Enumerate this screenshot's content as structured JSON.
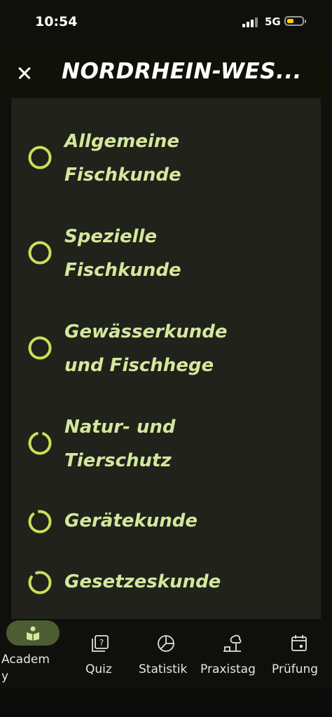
{
  "status_bar": {
    "time": "10:54",
    "network": "5G"
  },
  "header": {
    "title": "NORDRHEIN-WES..."
  },
  "topics": [
    {
      "line1": "Allgemeine",
      "line2": "Fischkunde",
      "progress": 0
    },
    {
      "line1": "Spezielle",
      "line2": "Fischkunde",
      "progress": 0
    },
    {
      "line1": "Gewässerkunde",
      "line2": "und Fischhege",
      "progress": 0
    },
    {
      "line1": "Natur- und",
      "line2": "Tierschutz",
      "progress": 0.1
    },
    {
      "line1": "Gerätekunde",
      "line2": "",
      "progress": 0.1
    },
    {
      "line1": "Gesetzeskunde",
      "line2": "",
      "progress": 0.1
    }
  ],
  "nav": {
    "academy": "Academ\ny",
    "quiz": "Quiz",
    "statistik": "Statistik",
    "praxistag": "Praxistag",
    "pruefung": "Prüfung"
  },
  "colors": {
    "accent": "#c8e05a",
    "topic_text": "#d4e79c",
    "panel": "#20221b",
    "active_pill": "#4b5d31"
  }
}
